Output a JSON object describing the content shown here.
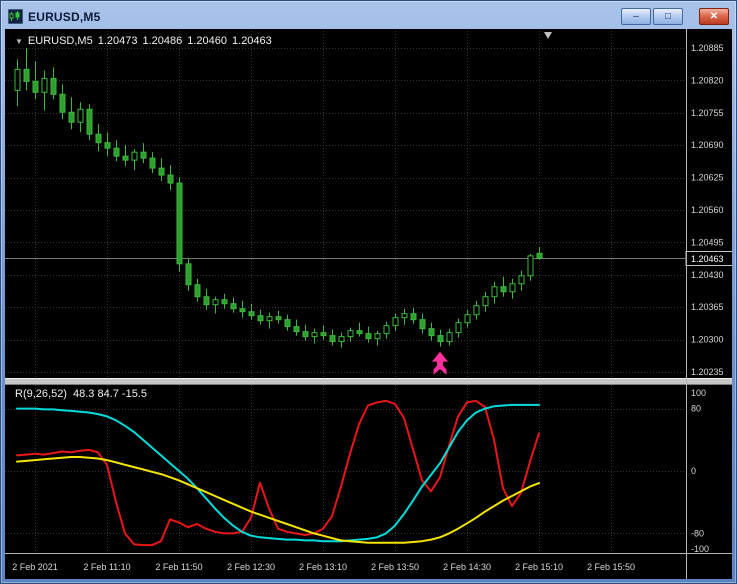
{
  "window": {
    "title": "EURUSD,M5",
    "controls": {
      "minimize": "–",
      "maximize": "□",
      "close": "✕"
    }
  },
  "ohlc_readout": {
    "collapse_icon": "▼",
    "symbol": "EURUSD,M5",
    "open": "1.20473",
    "high": "1.20486",
    "low": "1.20460",
    "close": "1.20463"
  },
  "indicator_readout": {
    "name": "R(9,26,52)",
    "values": "48.3 84.7 -15.5"
  },
  "colors": {
    "background": "#000000",
    "grid": "#34343e",
    "candle": "#3cb83c",
    "bull_fill": "#000000",
    "bear_fill": "#2e9e2e",
    "price_line": "#787878",
    "axis_text": "#d6d6d6",
    "arrow": "#ff2f9e",
    "series_red": "#e81717",
    "series_cyan": "#00dcdc",
    "series_yellow": "#f5e400"
  },
  "chart_data": {
    "type": "candlestick",
    "symbol": "EURUSD",
    "timeframe": "M5",
    "title": "EURUSD,M5",
    "current_price": 1.20463,
    "current_price_label": "1.20463",
    "shift_marker_index": 59,
    "price_axis": {
      "view_max": 1.20919,
      "view_min": 1.20225,
      "labels": [
        "1.20885",
        "1.20820",
        "1.20755",
        "1.20690",
        "1.20625",
        "1.20560",
        "1.20495",
        "1.20430",
        "1.20365",
        "1.20300",
        "1.20235"
      ]
    },
    "time_axis": {
      "labels": [
        "2 Feb 2021",
        "2 Feb 11:10",
        "2 Feb 11:50",
        "2 Feb 12:30",
        "2 Feb 13:10",
        "2 Feb 13:50",
        "2 Feb 14:30",
        "2 Feb 15:10",
        "2 Feb 15:50"
      ],
      "indices": [
        2,
        10,
        18,
        26,
        34,
        42,
        50,
        58,
        66
      ]
    },
    "candles": [
      [
        1.208,
        1.20862,
        1.20768,
        1.20842
      ],
      [
        1.20842,
        1.20885,
        1.208,
        1.20818
      ],
      [
        1.20818,
        1.20858,
        1.20782,
        1.20796
      ],
      [
        1.20796,
        1.2084,
        1.2076,
        1.20824
      ],
      [
        1.20824,
        1.20846,
        1.20782,
        1.20792
      ],
      [
        1.20792,
        1.20812,
        1.20742,
        1.20756
      ],
      [
        1.20756,
        1.20786,
        1.20722,
        1.20736
      ],
      [
        1.20736,
        1.20776,
        1.20716,
        1.20762
      ],
      [
        1.20762,
        1.20772,
        1.207,
        1.20712
      ],
      [
        1.20712,
        1.20732,
        1.20678,
        1.20695
      ],
      [
        1.20695,
        1.20716,
        1.20668,
        1.20684
      ],
      [
        1.20684,
        1.207,
        1.20658,
        1.20668
      ],
      [
        1.20668,
        1.2069,
        1.20648,
        1.2066
      ],
      [
        1.2066,
        1.20682,
        1.2064,
        1.20676
      ],
      [
        1.20676,
        1.20694,
        1.20654,
        1.20664
      ],
      [
        1.20664,
        1.20676,
        1.20634,
        1.20644
      ],
      [
        1.20644,
        1.20664,
        1.20618,
        1.2063
      ],
      [
        1.2063,
        1.2065,
        1.206,
        1.20614
      ],
      [
        1.20614,
        1.20626,
        1.20436,
        1.20452
      ],
      [
        1.20452,
        1.20462,
        1.20398,
        1.2041
      ],
      [
        1.2041,
        1.20422,
        1.20376,
        1.20386
      ],
      [
        1.20386,
        1.20402,
        1.2036,
        1.2037
      ],
      [
        1.2037,
        1.20386,
        1.20352,
        1.2038
      ],
      [
        1.2038,
        1.20392,
        1.20362,
        1.20372
      ],
      [
        1.20372,
        1.20384,
        1.20354,
        1.20362
      ],
      [
        1.20362,
        1.20378,
        1.20344,
        1.20356
      ],
      [
        1.20356,
        1.20372,
        1.2034,
        1.20348
      ],
      [
        1.20348,
        1.2036,
        1.2033,
        1.20338
      ],
      [
        1.20338,
        1.20354,
        1.20322,
        1.20346
      ],
      [
        1.20346,
        1.20358,
        1.20332,
        1.2034
      ],
      [
        1.2034,
        1.2035,
        1.20318,
        1.20326
      ],
      [
        1.20326,
        1.2034,
        1.20308,
        1.20316
      ],
      [
        1.20316,
        1.2033,
        1.20298,
        1.20306
      ],
      [
        1.20306,
        1.20322,
        1.20292,
        1.20314
      ],
      [
        1.20314,
        1.20328,
        1.203,
        1.20308
      ],
      [
        1.20308,
        1.2032,
        1.20288,
        1.20296
      ],
      [
        1.20296,
        1.20314,
        1.20284,
        1.20306
      ],
      [
        1.20306,
        1.20324,
        1.20296,
        1.20318
      ],
      [
        1.20318,
        1.20334,
        1.20306,
        1.20312
      ],
      [
        1.20312,
        1.20326,
        1.20294,
        1.20302
      ],
      [
        1.20302,
        1.20318,
        1.20288,
        1.20312
      ],
      [
        1.20312,
        1.20336,
        1.20302,
        1.20328
      ],
      [
        1.20328,
        1.20352,
        1.20318,
        1.20344
      ],
      [
        1.20344,
        1.20362,
        1.2033,
        1.20352
      ],
      [
        1.20352,
        1.20364,
        1.20332,
        1.2034
      ],
      [
        1.2034,
        1.20352,
        1.20312,
        1.20322
      ],
      [
        1.20322,
        1.20334,
        1.20298,
        1.20308
      ],
      [
        1.20308,
        1.2032,
        1.20286,
        1.20296
      ],
      [
        1.20296,
        1.20322,
        1.20288,
        1.20314
      ],
      [
        1.20314,
        1.20342,
        1.20304,
        1.20334
      ],
      [
        1.20334,
        1.2036,
        1.20324,
        1.2035
      ],
      [
        1.2035,
        1.20378,
        1.2034,
        1.20368
      ],
      [
        1.20368,
        1.20396,
        1.20356,
        1.20386
      ],
      [
        1.20386,
        1.20416,
        1.20372,
        1.20406
      ],
      [
        1.20406,
        1.20426,
        1.20386,
        1.20396
      ],
      [
        1.20396,
        1.20422,
        1.20382,
        1.20412
      ],
      [
        1.20412,
        1.20438,
        1.20398,
        1.20428
      ],
      [
        1.20428,
        1.20472,
        1.20418,
        1.20468
      ],
      [
        1.20473,
        1.20486,
        1.2046,
        1.20463
      ]
    ],
    "marker": {
      "type": "buy-arrow",
      "index": 47,
      "color": "#ff2f9e"
    },
    "oscillator": {
      "name": "R(9,26,52)",
      "last_values": [
        48.3,
        84.7,
        -15.5
      ],
      "scale": {
        "max": 100,
        "min": -100,
        "labels": [
          "100",
          "80",
          "0",
          "-80",
          "-100"
        ],
        "levels": [
          80,
          0,
          -80
        ]
      },
      "series": [
        {
          "name": "fast",
          "color": "#e81717",
          "values": [
            20,
            21,
            22,
            21,
            23,
            25,
            24,
            26,
            27,
            24,
            8,
            -40,
            -80,
            -94,
            -95,
            -95,
            -90,
            -62,
            -66,
            -72,
            -68,
            -74,
            -78,
            -80,
            -80,
            -78,
            -60,
            -15,
            -48,
            -74,
            -78,
            -80,
            -82,
            -80,
            -74,
            -58,
            -20,
            22,
            60,
            84,
            88,
            90,
            86,
            68,
            28,
            -12,
            -26,
            -8,
            32,
            70,
            88,
            90,
            82,
            40,
            -22,
            -45,
            -28,
            12,
            48.3
          ]
        },
        {
          "name": "mid",
          "color": "#00dcdc",
          "values": [
            80,
            80,
            80,
            79,
            79,
            78,
            77,
            76,
            75,
            73,
            70,
            65,
            58,
            50,
            40,
            30,
            20,
            10,
            0,
            -10,
            -22,
            -35,
            -48,
            -60,
            -70,
            -78,
            -83,
            -85,
            -86,
            -87,
            -88,
            -88,
            -89,
            -89,
            -90,
            -90,
            -90,
            -89,
            -88,
            -87,
            -85,
            -80,
            -70,
            -55,
            -38,
            -20,
            -5,
            10,
            30,
            50,
            65,
            75,
            80,
            83,
            84,
            84.7,
            84.7,
            84.7,
            84.7
          ]
        },
        {
          "name": "slow",
          "color": "#f5e400",
          "values": [
            12,
            13,
            14,
            15,
            16,
            17,
            18,
            18,
            17,
            16,
            14,
            11,
            8,
            5,
            2,
            -1,
            -4,
            -8,
            -12,
            -17,
            -22,
            -27,
            -32,
            -37,
            -42,
            -47,
            -52,
            -56,
            -60,
            -64,
            -68,
            -72,
            -76,
            -80,
            -83,
            -86,
            -89,
            -90,
            -91,
            -92,
            -92,
            -92,
            -92,
            -92,
            -91,
            -90,
            -88,
            -85,
            -80,
            -74,
            -67,
            -60,
            -52,
            -45,
            -38,
            -32,
            -26,
            -20,
            -15.5
          ]
        }
      ]
    }
  }
}
